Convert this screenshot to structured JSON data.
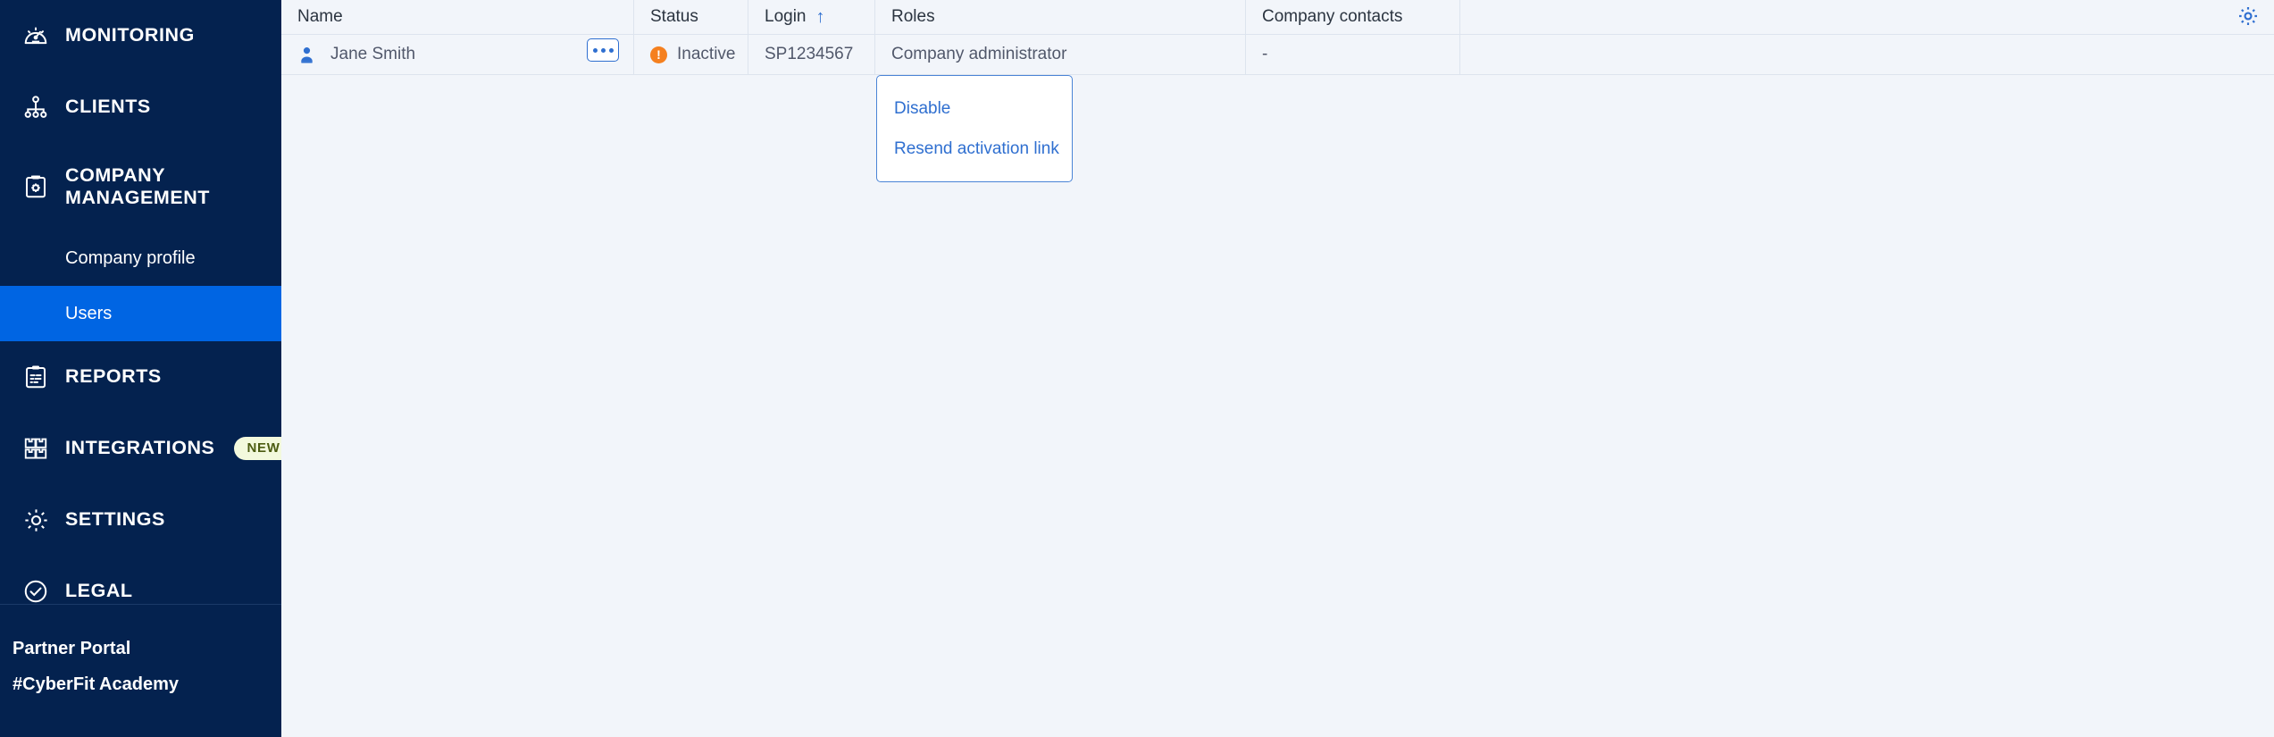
{
  "sidebar": {
    "nav": [
      {
        "label": "MONITORING",
        "icon": "gauge-icon",
        "key": "monitoring"
      },
      {
        "label": "CLIENTS",
        "icon": "org-tree-icon",
        "key": "clients"
      },
      {
        "label": "COMPANY\nMANAGEMENT",
        "icon": "clipboard-gear-icon",
        "key": "company-management"
      },
      {
        "label": "REPORTS",
        "icon": "clipboard-list-icon",
        "key": "reports"
      },
      {
        "label": "INTEGRATIONS",
        "icon": "grid-boxes-icon",
        "key": "integrations",
        "badge": "NEW"
      },
      {
        "label": "SETTINGS",
        "icon": "gear-icon",
        "key": "settings"
      },
      {
        "label": "LEGAL",
        "icon": "check-circle-icon",
        "key": "legal"
      }
    ],
    "sub_items": [
      {
        "label": "Company profile",
        "key": "company-profile",
        "active": false
      },
      {
        "label": "Users",
        "key": "users",
        "active": true
      }
    ],
    "footer": [
      {
        "label": "Partner Portal",
        "key": "partner-portal"
      },
      {
        "label": "#CyberFit Academy",
        "key": "cyberfit-academy"
      }
    ],
    "colors": {
      "background": "#04224f",
      "active": "#0065e3",
      "badge_bg": "#f3f9dd",
      "badge_text": "#4c5c12"
    }
  },
  "table": {
    "columns": [
      {
        "label": "Name",
        "key": "name"
      },
      {
        "label": "Status",
        "key": "status"
      },
      {
        "label": "Login",
        "key": "login",
        "sorted": "asc",
        "sort_glyph": "↑"
      },
      {
        "label": "Roles",
        "key": "roles"
      },
      {
        "label": "Company contacts",
        "key": "company_contacts"
      }
    ],
    "rows": [
      {
        "name": "Jane Smith",
        "status": "Inactive",
        "status_color": "#f5801f",
        "status_glyph": "!",
        "login": "SP1234567",
        "roles": "Company administrator",
        "company_contacts": "-",
        "kebab_label": "•••"
      }
    ]
  },
  "dropdown": {
    "items": [
      {
        "label": "Disable",
        "key": "disable"
      },
      {
        "label": "Resend activation link",
        "key": "resend-activation-link"
      }
    ]
  },
  "toolbar": {
    "settings_icon": "gear-icon"
  }
}
